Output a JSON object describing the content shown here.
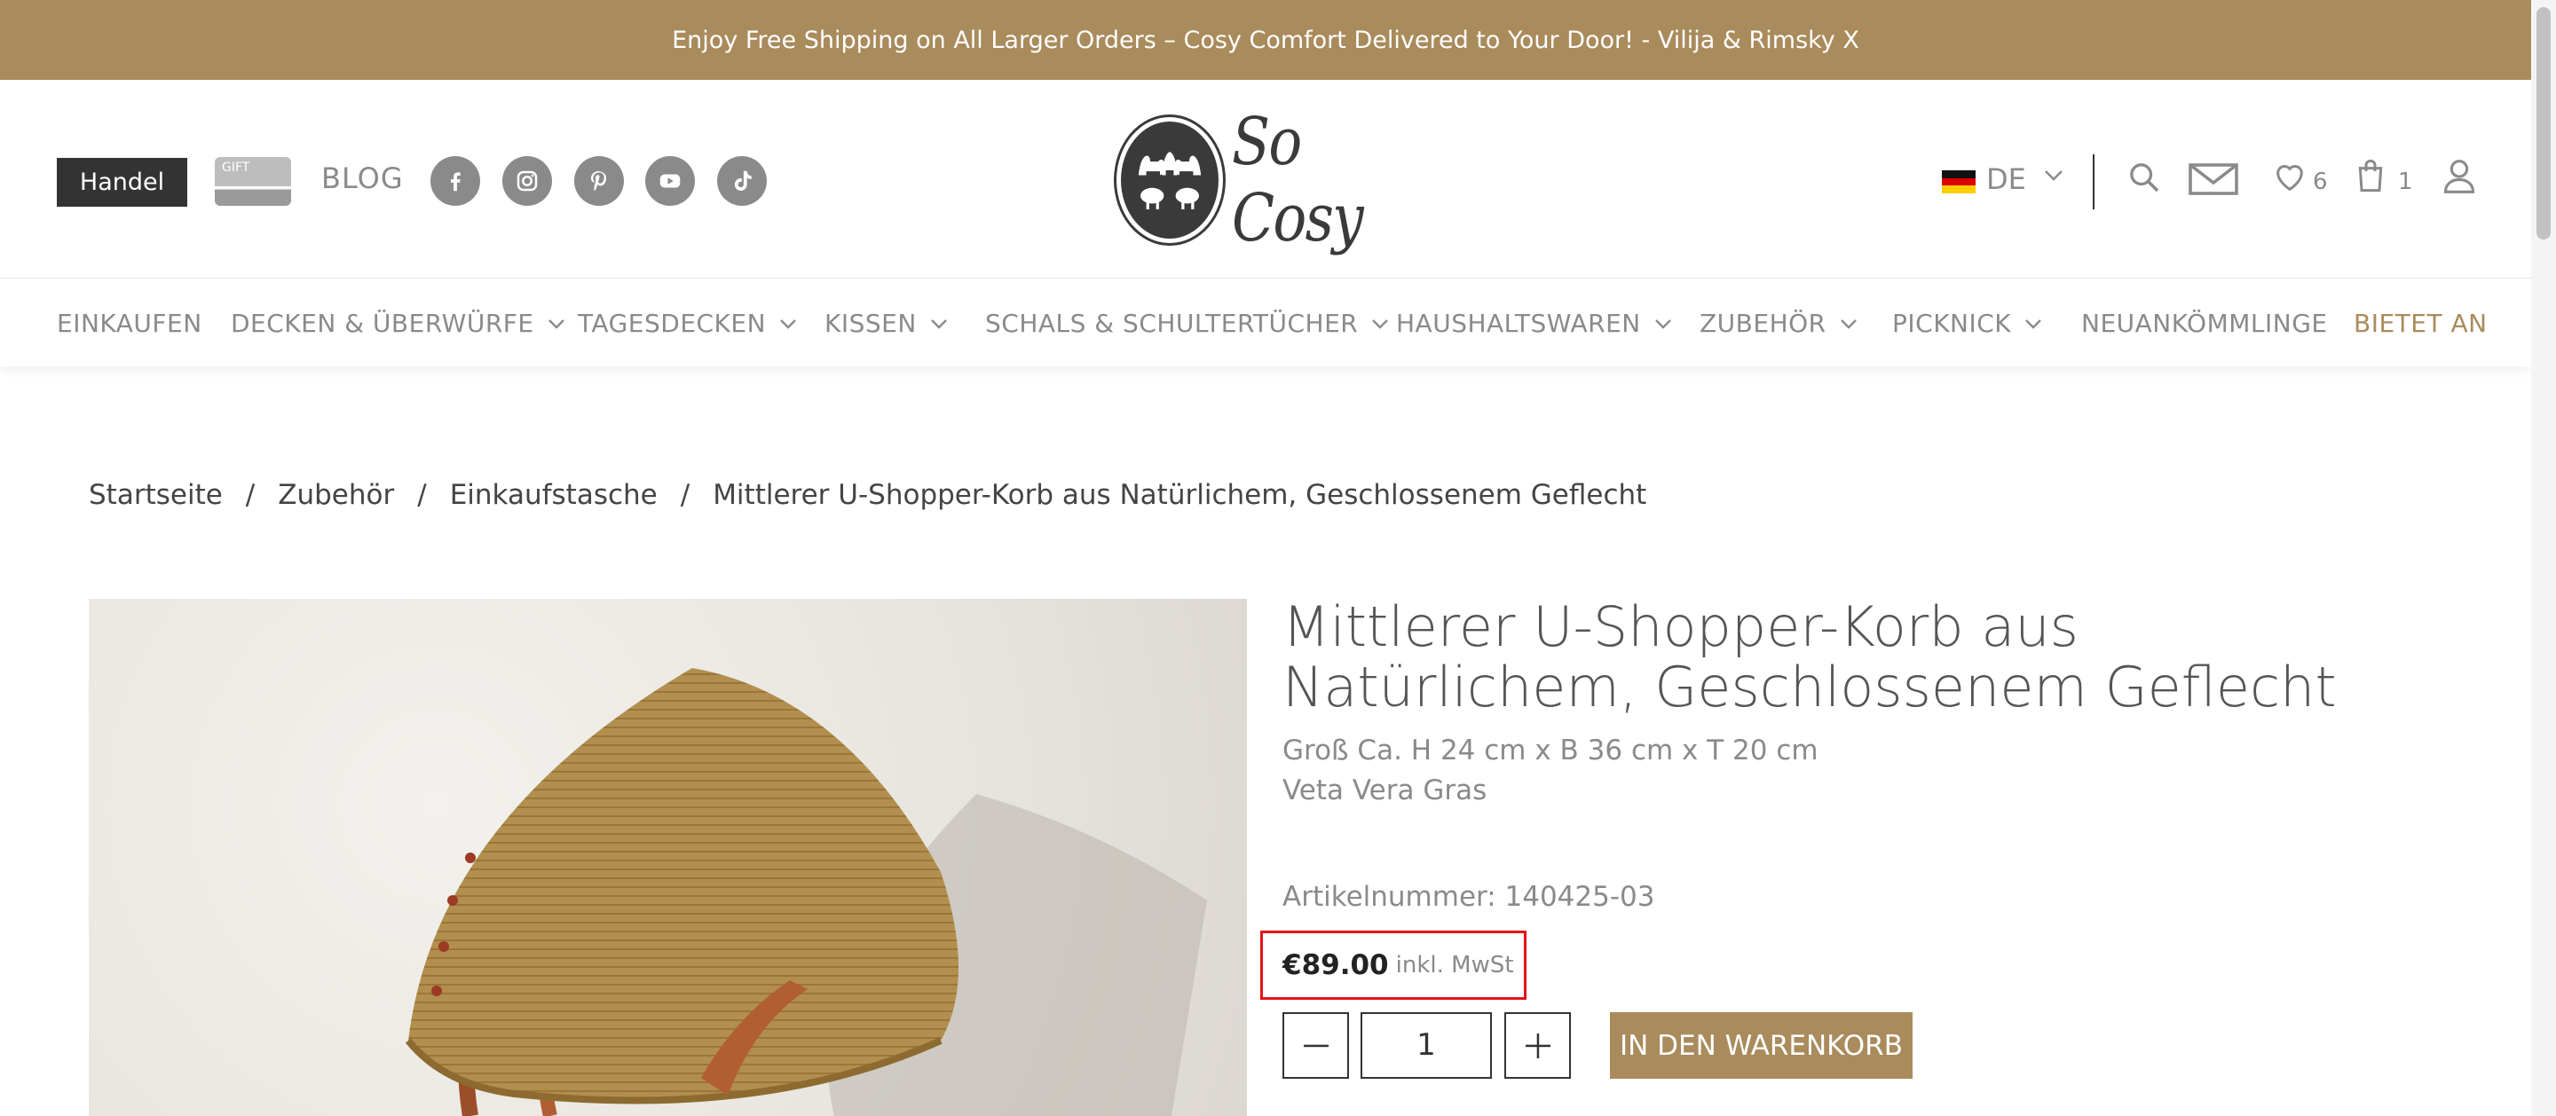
{
  "announcement": "Enjoy Free Shipping on All Larger Orders – Cosy Comfort Delivered to Your Door! - Vilija & Rimsky X",
  "header": {
    "handel_label": "Handel",
    "gift_label": "GIFT",
    "blog_label": "BLOG",
    "social_icons": [
      "facebook-icon",
      "instagram-icon",
      "pinterest-icon",
      "youtube-icon",
      "tiktok-icon"
    ],
    "logo_text": "So Cosy",
    "language": "DE",
    "wishlist_count": "6",
    "cart_count": "1"
  },
  "nav": {
    "items": [
      {
        "label": "EINKAUFEN"
      },
      {
        "label": "DECKEN & ÜBERWÜRFE"
      },
      {
        "label": "TAGESDECKEN"
      },
      {
        "label": "KISSEN"
      },
      {
        "label": "SCHALS & SCHULTERTÜCHER"
      },
      {
        "label": "HAUSHALTSWAREN"
      },
      {
        "label": "ZUBEHÖR"
      },
      {
        "label": "PICKNICK"
      },
      {
        "label": "NEUANKÖMMLINGE"
      },
      {
        "label": "BIETET AN"
      }
    ]
  },
  "breadcrumb": {
    "items": [
      "Startseite",
      "Zubehör",
      "Einkaufstasche",
      "Mittlerer U-Shopper-Korb aus Natürlichem, Geschlossenem Geflecht"
    ],
    "separator": "/"
  },
  "product": {
    "title": "Mittlerer U-Shopper-Korb aus Natürlichem, Geschlossenem Geflecht",
    "size": "Groß Ca. H 24 cm x B 36 cm x T 20 cm",
    "material": "Veta Vera Gras",
    "sku": "Artikelnummer: 140425-03",
    "price": "€89.00",
    "tax_note": "inkl. MwSt",
    "quantity": "1",
    "add_to_cart": "IN DEN WARENKORB"
  },
  "colors": {
    "brand": "#a98b5c",
    "price_highlight": "#e3141a",
    "dark": "#333333"
  }
}
